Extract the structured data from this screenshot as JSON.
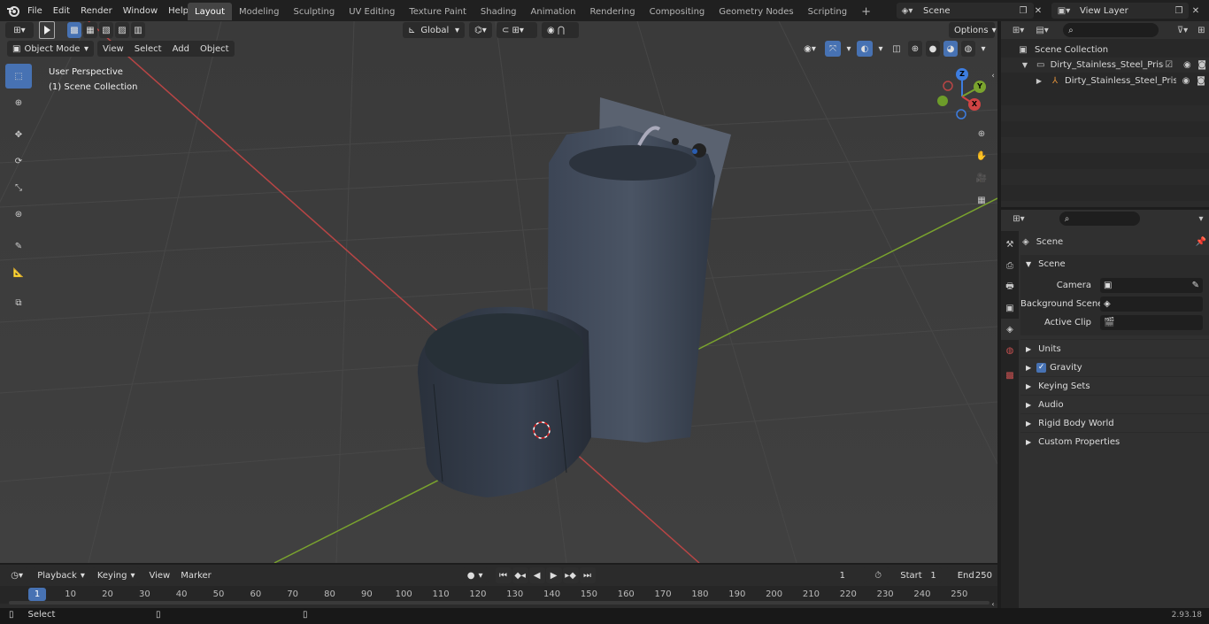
{
  "topbar": {
    "menus": [
      "File",
      "Edit",
      "Render",
      "Window",
      "Help"
    ],
    "workspaces": [
      "Layout",
      "Modeling",
      "Sculpting",
      "UV Editing",
      "Texture Paint",
      "Shading",
      "Animation",
      "Rendering",
      "Compositing",
      "Geometry Nodes",
      "Scripting"
    ],
    "active_workspace": "Layout",
    "scene_name": "Scene",
    "view_layer": "View Layer"
  },
  "viewport": {
    "mode": "Object Mode",
    "menus": [
      "View",
      "Select",
      "Add",
      "Object"
    ],
    "transform_orientation": "Global",
    "options_label": "Options",
    "overlay_title": "User Perspective",
    "overlay_subtitle": "(1) Scene Collection",
    "gizmo": {
      "z": "Z",
      "y": "Y",
      "x": "X"
    }
  },
  "outliner": {
    "root": "Scene Collection",
    "item1": "Dirty_Stainless_Steel_Prison_T",
    "item2": "Dirty_Stainless_Steel_Pris"
  },
  "properties": {
    "context": "Scene",
    "panel": "Scene",
    "camera_label": "Camera",
    "background_label": "Background Scene",
    "clip_label": "Active Clip",
    "sections": [
      "Units",
      "Gravity",
      "Keying Sets",
      "Audio",
      "Rigid Body World",
      "Custom Properties"
    ],
    "gravity_checked": true
  },
  "timeline": {
    "menus": [
      "Playback",
      "Keying",
      "View",
      "Marker"
    ],
    "current_frame": "1",
    "start_label": "Start",
    "start": "1",
    "end_label": "End",
    "end": "250",
    "ticks": [
      "1",
      "10",
      "20",
      "30",
      "40",
      "50",
      "60",
      "70",
      "80",
      "90",
      "100",
      "110",
      "120",
      "130",
      "140",
      "150",
      "160",
      "170",
      "180",
      "190",
      "200",
      "210",
      "220",
      "230",
      "240",
      "250"
    ]
  },
  "statusbar": {
    "left": "Select",
    "version": "2.93.18"
  },
  "colors": {
    "accent": "#4772b3",
    "x_axis": "#c84a4a",
    "y_axis": "#7aa32e"
  }
}
